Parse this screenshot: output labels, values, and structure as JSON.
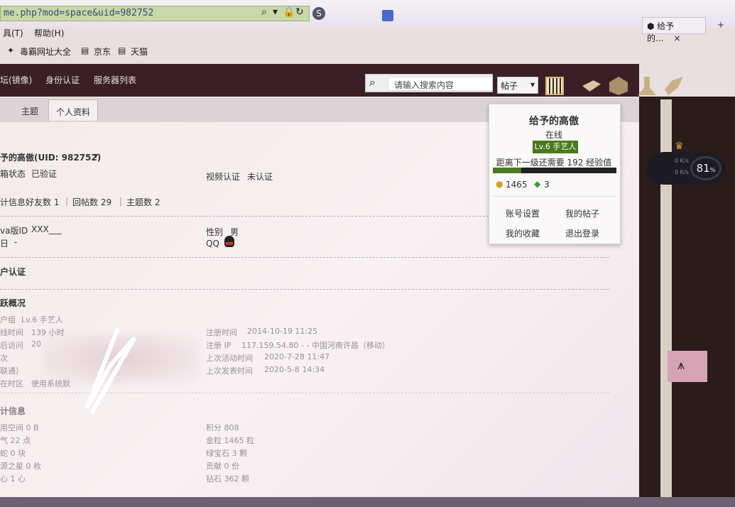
{
  "browser": {
    "url": "me.php?mod=space&uid=982752",
    "tab_title": "给予的...",
    "menu": [
      "具(T)",
      "帮助(H)"
    ],
    "favorites": [
      "毒霸网址大全",
      "京东",
      "天猫"
    ]
  },
  "nav": {
    "links": [
      "坛(镜像)",
      "身份认证",
      "服务器列表"
    ],
    "search_placeholder": "请输入搜索内容",
    "search_type": "帖子"
  },
  "tabs": [
    "主题",
    "个人资料"
  ],
  "profile": {
    "name_uid": "予的高傲(UID: 982752)",
    "email_status_label": "箱状态",
    "email_status": "已验证",
    "video_label": "视频认证",
    "video_status": "未认证",
    "stats_label": "计信息",
    "stats": [
      "好友数 1",
      "回帖数 29",
      "主题数 2"
    ],
    "game_id_label": "va版ID",
    "game_id": "XXX___",
    "birthday_label": "日",
    "birthday": "-",
    "gender_label": "性别",
    "gender": "男",
    "qq_label": "QQ",
    "user_verify": "户认证",
    "activity_title": "跃概况",
    "group_label": "户组",
    "group": "Lv.6 手艺人",
    "online_label": "线时间",
    "online_time": "139 小时",
    "last_visit_label": "后访问",
    "last_visit": "20",
    "tz_label": "在时区",
    "tz_value": "使用系统默",
    "other_label1": "次",
    "other_label2": "联通）",
    "reg_time_label": "注册时间",
    "reg_time": "2014-10-19 11:25",
    "reg_ip_label": "注册 IP",
    "reg_ip": "117.159.54.80 - - 中国河南许昌（移动）",
    "last_active_label": "上次活动时间",
    "last_active": "2020-7-28 11:47",
    "last_post_label": "上次发表时间",
    "last_post": "2020-5-8 14:34",
    "stats2_title": "计信息",
    "left_stats": [
      "用空间  0 B",
      "气  22 点",
      "蛇  0 块",
      "源之星  0 枚",
      "心  1 心"
    ],
    "right_stats": [
      "积分  808",
      "金粒  1465 粒",
      "绿宝石  3 颗",
      "贡献  0 份",
      "钻石  362 颗"
    ]
  },
  "popup": {
    "name": "给予的高傲",
    "status": "在线",
    "level": "Lv.6 手艺人",
    "next_level": "距离下一级还需要 192 经验值",
    "coins": "1465",
    "gems": "3",
    "links": [
      "账号设置",
      "我的帖子",
      "我的收藏",
      "退出登录"
    ],
    "progress": 0.23
  },
  "widget": {
    "percent": "81"
  },
  "colors": {
    "nav": "#3a2026",
    "level_badge": "#4a7a20",
    "url_bar": "#c8d8a8"
  }
}
